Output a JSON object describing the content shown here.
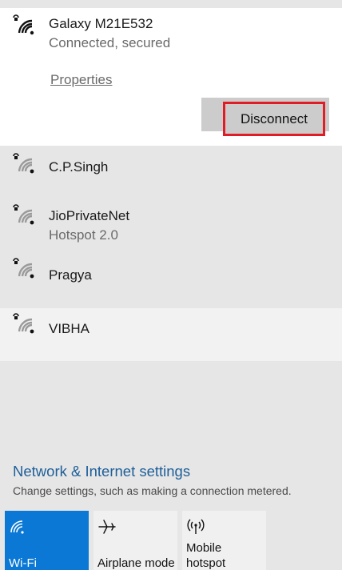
{
  "connected_network": {
    "name": "Galaxy M21E532",
    "status": "Connected, secured",
    "properties_label": "Properties",
    "disconnect_label": "Disconnect",
    "icon": "wifi-secured-full-icon"
  },
  "networks": [
    {
      "name": "C.P.Singh",
      "sub": "",
      "icon": "wifi-secured-weak-icon"
    },
    {
      "name": "JioPrivateNet",
      "sub": "Hotspot 2.0",
      "icon": "wifi-secured-weak-icon"
    },
    {
      "name": "Pragya",
      "sub": "",
      "icon": "wifi-secured-weak-icon"
    },
    {
      "name": "VIBHA",
      "sub": "",
      "icon": "wifi-secured-weak-icon"
    }
  ],
  "settings": {
    "link_label": "Network & Internet settings",
    "description": "Change settings, such as making a connection metered."
  },
  "tiles": [
    {
      "label": "Wi-Fi",
      "icon": "wifi-icon",
      "active": true
    },
    {
      "label": "Airplane mode",
      "icon": "airplane-icon",
      "active": false
    },
    {
      "label_line1": "Mobile",
      "label_line2": "hotspot",
      "icon": "hotspot-icon",
      "active": false
    }
  ],
  "colors": {
    "accent": "#0a78d4",
    "link": "#1e5f99",
    "highlight_border": "#e01c24",
    "panel_bg": "#e6e6e6",
    "hover_row_bg": "#f2f2f2"
  }
}
